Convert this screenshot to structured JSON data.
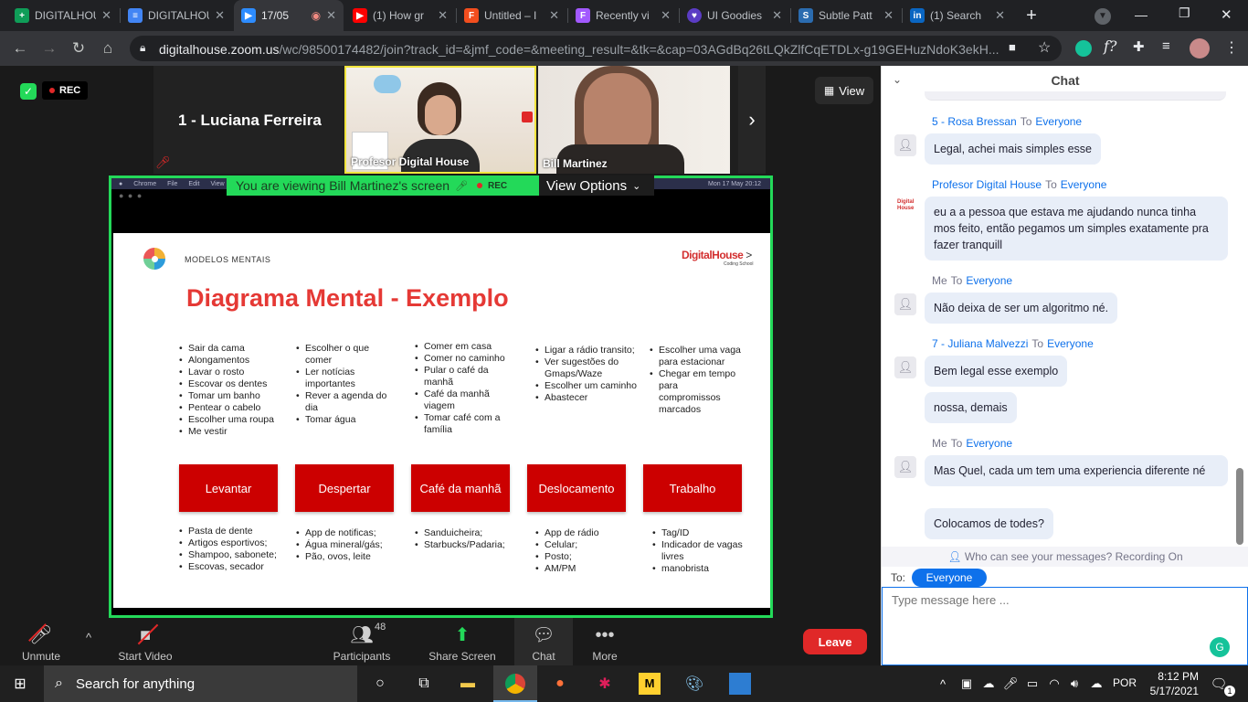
{
  "browser": {
    "tabs": [
      {
        "label": "DIGITALHOUSE",
        "icon": "sheets-icon",
        "color": "#0f9d58",
        "active": false
      },
      {
        "label": "DIGITALHOUSE",
        "icon": "docs-icon",
        "color": "#4285f4",
        "active": false
      },
      {
        "label": "17/05",
        "icon": "zoom-icon",
        "color": "#2d8cff",
        "active": true
      },
      {
        "label": "(1) How gr",
        "icon": "youtube-icon",
        "color": "#ff0000",
        "active": false
      },
      {
        "label": "Untitled – I",
        "icon": "figma-icon",
        "color": "#f24e1e",
        "active": false
      },
      {
        "label": "Recently vi",
        "icon": "figma-icon",
        "color": "#a259ff",
        "active": false
      },
      {
        "label": "UI Goodies",
        "icon": "heart-icon",
        "color": "#5b3cc4",
        "active": false
      },
      {
        "label": "Subtle Patt",
        "icon": "subtle-patterns-icon",
        "color": "#2b6cb0",
        "active": false
      },
      {
        "label": "(1) Search",
        "icon": "linkedin-icon",
        "color": "#0a66c2",
        "active": false
      }
    ],
    "url_host": "digitalhouse.zoom.us",
    "url_path": "/wc/98500174482/join?track_id=&jmf_code=&meeting_result=&tk=&cap=03AGdBq26tLQkZlfCqETDLx-g19GEHuzNdoK3ekH..."
  },
  "meeting": {
    "rec_label": "REC",
    "active_speaker": "1 - Luciana Ferreira",
    "view_label": "View",
    "participants": [
      {
        "name": "Profesor Digital House"
      },
      {
        "name": "Bill Martinez"
      }
    ],
    "viewing_banner": "You are viewing Bill Martinez's screen",
    "banner_rec": "REC",
    "view_options": "View Options"
  },
  "slide": {
    "header_label": "MODELOS MENTAIS",
    "brand": "DigitalHouse",
    "brand_sub": "Coding School",
    "title": "Diagrama Mental - Exemplo",
    "columns": [
      {
        "top": [
          "Sair da cama",
          "Alongamentos",
          "Lavar o rosto",
          "Escovar os dentes",
          "Tomar um banho",
          "Pentear o cabelo",
          "Escolher uma roupa",
          "Me vestir"
        ],
        "box": "Levantar",
        "bottom": [
          "Pasta de dente",
          "Artigos esportivos;",
          "Shampoo, sabonete;",
          "Escovas, secador"
        ]
      },
      {
        "top": [
          "Escolher o que comer",
          "Ler notícias importantes",
          "Rever a agenda do dia",
          "Tomar água"
        ],
        "box": "Despertar",
        "bottom": [
          "App de notificas;",
          "Água mineral/gás;",
          "Pão, ovos, leite"
        ]
      },
      {
        "top": [
          "Comer em casa",
          "Comer no caminho",
          "Pular o café da manhã",
          "Café da manhã viagem",
          "Tomar café com a família"
        ],
        "box": "Café da manhã",
        "bottom": [
          "Sanduicheira;",
          "Starbucks/Padaria;"
        ]
      },
      {
        "top": [
          "Ligar a rádio transito;",
          "Ver sugestões do Gmaps/Waze",
          "Escolher um caminho",
          "Abastecer"
        ],
        "box": "Deslocamento",
        "bottom": [
          "App de rádio",
          "Celular;",
          "Posto;",
          "AM/PM"
        ]
      },
      {
        "top": [
          "Escolher uma vaga para estacionar",
          "Chegar em tempo para compromissos marcados"
        ],
        "box": "Trabalho",
        "bottom": [
          "Tag/ID",
          "Indicador de vagas livres",
          "manobrista"
        ]
      }
    ],
    "mac_menu": [
      "Chrome",
      "File",
      "Edit",
      "View"
    ],
    "mac_clock": "Mon 17 May  20:12"
  },
  "toolbar": {
    "unmute": "Unmute",
    "start_video": "Start Video",
    "participants": "Participants",
    "participants_count": "48",
    "share_screen": "Share Screen",
    "chat": "Chat",
    "more": "More",
    "leave": "Leave"
  },
  "chat": {
    "title": "Chat",
    "messages": [
      {
        "sender": "5 - Rosa Bressan",
        "to": "To",
        "recipient": "Everyone",
        "texts": [
          "Legal, achei mais simples esse"
        ]
      },
      {
        "sender": "Profesor Digital House",
        "to": "To",
        "recipient": "Everyone",
        "texts": [
          "eu a a pessoa que estava me ajudando nunca tinha mos feito, então pegamos um simples exatamente pra fazer tranquill"
        ]
      },
      {
        "sender": "Me",
        "to": "To",
        "recipient": "Everyone",
        "texts": [
          "Não deixa de ser um algoritmo né."
        ]
      },
      {
        "sender": "7 - Juliana Malvezzi",
        "to": "To",
        "recipient": "Everyone",
        "texts": [
          "Bem legal esse exemplo",
          "nossa, demais"
        ]
      },
      {
        "sender": "Me",
        "to": "To",
        "recipient": "Everyone",
        "texts": [
          "Mas Quel, cada um tem uma experiencia diferente né",
          "Colocamos de todes?"
        ]
      }
    ],
    "privacy_note": "Who can see your messages? Recording On",
    "to_label": "To:",
    "recipient_button": "Everyone",
    "input_placeholder": "Type message here ..."
  },
  "taskbar": {
    "search_placeholder": "Search for anything",
    "language": "POR",
    "time": "8:12 PM",
    "date": "5/17/2021",
    "notifications": "1"
  }
}
